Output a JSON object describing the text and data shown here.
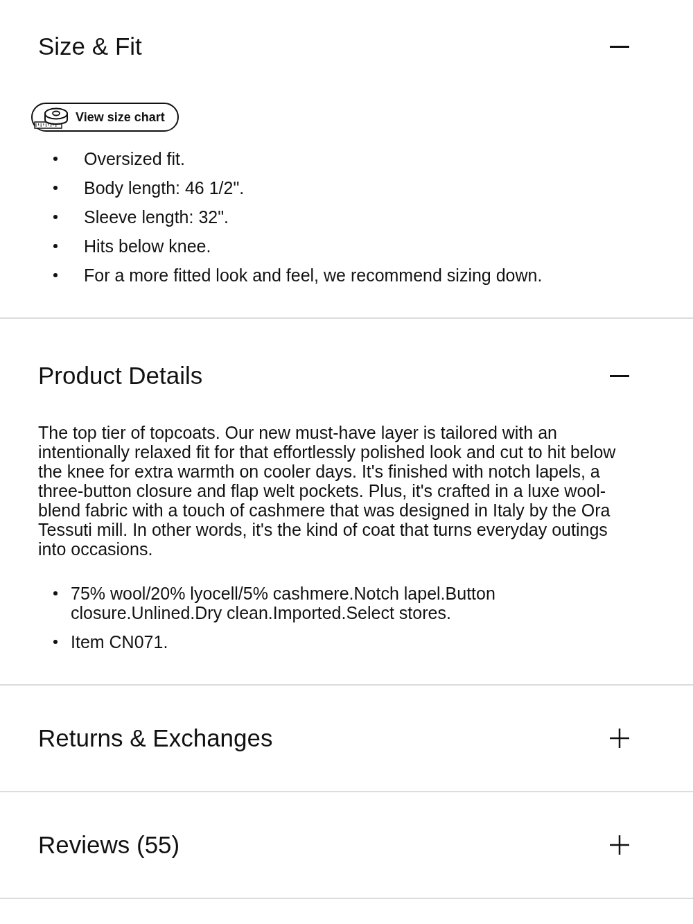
{
  "sections": [
    {
      "title": "Size & Fit",
      "expanded": true,
      "kind": "fit",
      "size_chart_button": {
        "label": "View size chart"
      },
      "bullets": [
        "Oversized fit.",
        "Body length: 46 1/2\".",
        "Sleeve length: 32\".",
        "Hits below knee.",
        "For a more fitted look and feel, we recommend sizing down."
      ]
    },
    {
      "title": "Product Details",
      "expanded": true,
      "kind": "details",
      "description": "The top tier of topcoats. Our new must-have layer is tailored with an intentionally relaxed fit for that effortlessly polished look and cut to hit below the knee for extra warmth on cooler days. It's finished with notch lapels, a three-button closure and flap welt pockets. Plus, it's crafted in a luxe wool-blend fabric with a touch of cashmere that was designed in Italy by the Ora Tessuti mill. In other words, it's the kind of coat that turns everyday outings into occasions.",
      "bullets": [
        "75% wool/20% lyocell/5% cashmere.Notch lapel.Button closure.Unlined.Dry clean.Imported.Select stores.",
        "Item CN071."
      ]
    },
    {
      "title": "Returns & Exchanges",
      "expanded": false
    },
    {
      "title": "Reviews (55)",
      "expanded": false
    }
  ]
}
